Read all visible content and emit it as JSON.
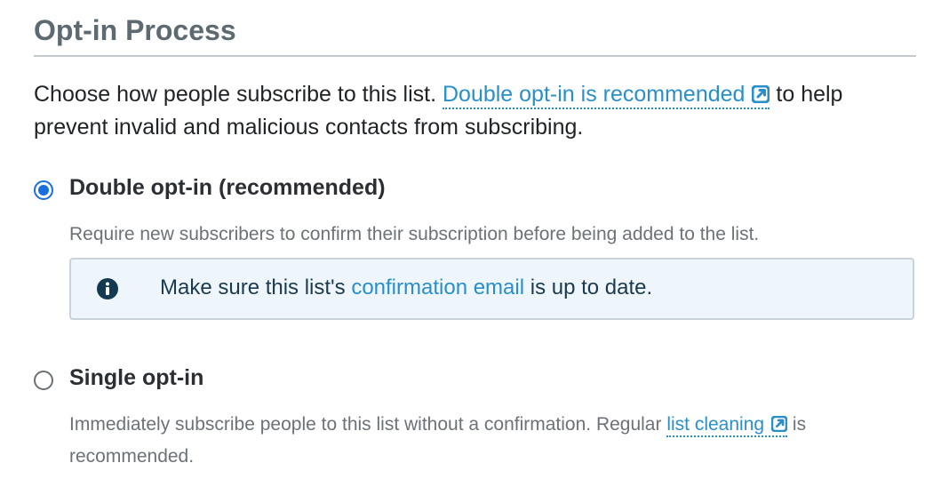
{
  "section": {
    "title": "Opt-in Process",
    "intro_before": "Choose how people subscribe to this list. ",
    "intro_link": "Double opt-in is recommended",
    "intro_after": " to help prevent invalid and malicious contacts from subscribing."
  },
  "options": {
    "double": {
      "label": "Double opt-in (recommended)",
      "selected": true,
      "description": "Require new subscribers to confirm their subscription before being added to the list.",
      "info_before": "Make sure this list's ",
      "info_link": "confirmation email",
      "info_after": " is up to date."
    },
    "single": {
      "label": "Single opt-in",
      "selected": false,
      "description_before": "Immediately subscribe people to this list without a confirmation. Regular ",
      "description_link": "list cleaning",
      "description_after": " is recommended."
    }
  },
  "icons": {
    "external_link": "external-link-icon",
    "info": "info-icon"
  },
  "colors": {
    "link": "#2a8fc9",
    "radio_selected": "#1a6fe0",
    "info_bg": "#eef6fc",
    "title": "#5e6a72"
  }
}
